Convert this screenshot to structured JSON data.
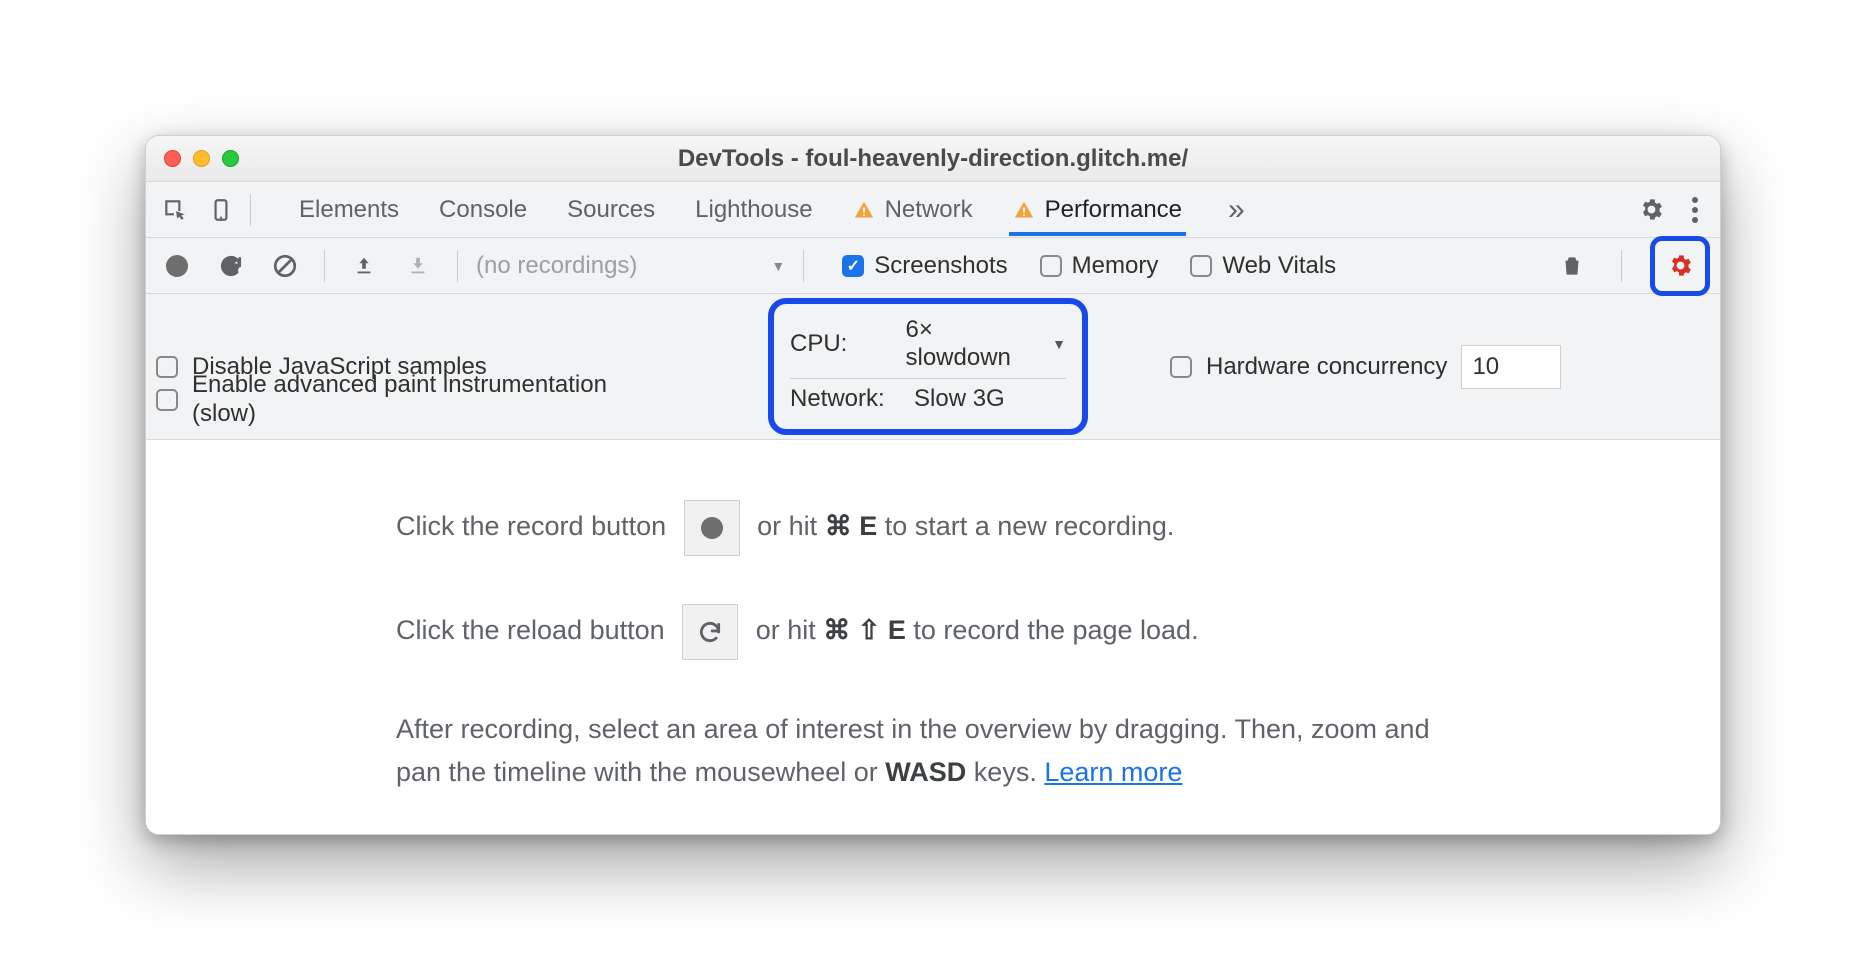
{
  "window": {
    "title": "DevTools - foul-heavenly-direction.glitch.me/"
  },
  "tabs": {
    "items": [
      "Elements",
      "Console",
      "Sources",
      "Lighthouse",
      "Network",
      "Performance"
    ],
    "active": "Performance",
    "more": "»"
  },
  "toolbar": {
    "recordings_placeholder": "(no recordings)",
    "screenshots_label": "Screenshots",
    "memory_label": "Memory",
    "webvitals_label": "Web Vitals",
    "screenshots_checked": true,
    "memory_checked": false,
    "webvitals_checked": false
  },
  "settings": {
    "disable_js_label": "Disable JavaScript samples",
    "paint_instr_label": "Enable advanced paint instrumentation (slow)",
    "cpu_label": "CPU:",
    "cpu_value": "6× slowdown",
    "network_label": "Network:",
    "network_value": "Slow 3G",
    "hw_concurrency_label": "Hardware concurrency",
    "hw_concurrency_value": "10"
  },
  "instructions": {
    "line1a": "Click the record button ",
    "line1b": " or hit ",
    "line1_key": "⌘ E",
    "line1c": " to start a new recording.",
    "line2a": "Click the reload button ",
    "line2b": " or hit ",
    "line2_key": "⌘ ⇧ E",
    "line2c": " to record the page load.",
    "line3a": "After recording, select an area of interest in the overview by dragging. Then, zoom and pan the timeline with the mousewheel or ",
    "line3_wasd": "WASD",
    "line3b": " keys. ",
    "learn_more": "Learn more"
  }
}
